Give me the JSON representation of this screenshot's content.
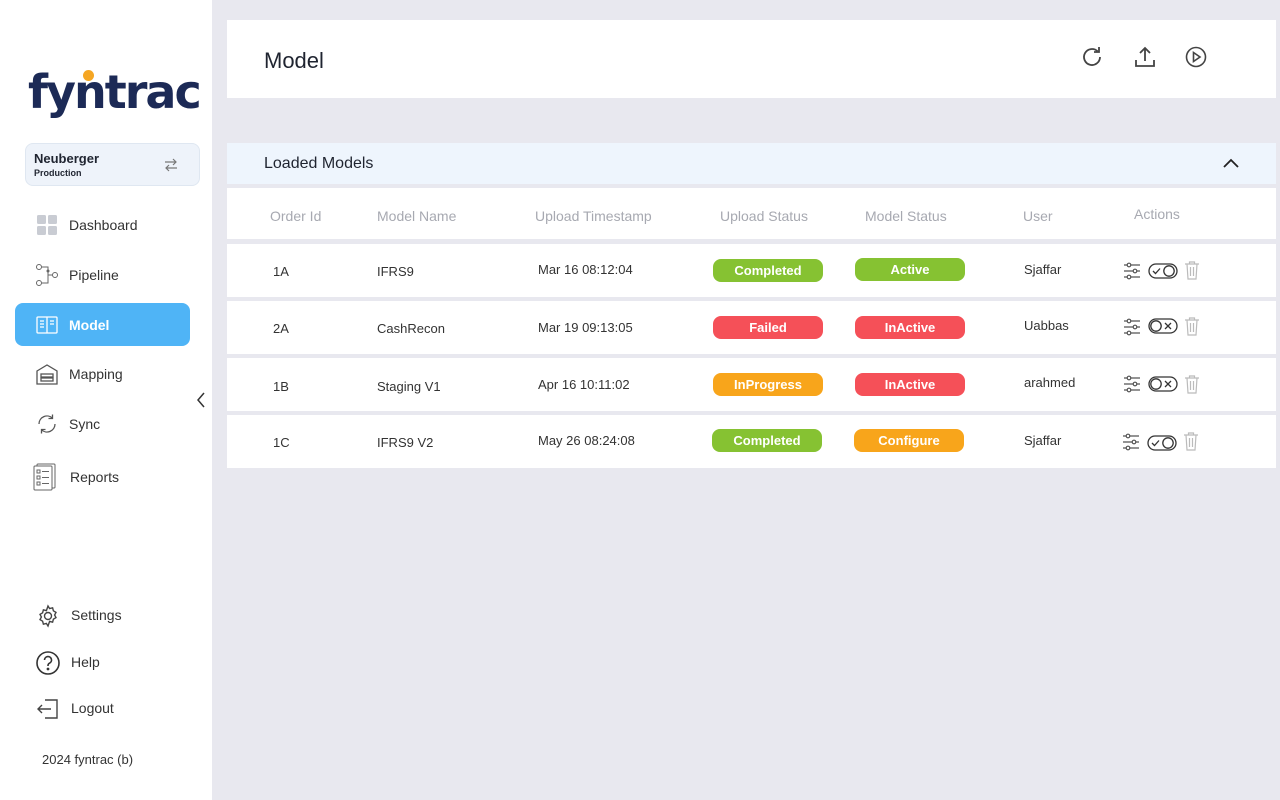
{
  "brand": {
    "logo_text": "fyntrac"
  },
  "org": {
    "name": "Neuberger",
    "environment": "Production"
  },
  "sidebar": {
    "items": [
      {
        "label": "Dashboard",
        "icon": "dashboard-icon"
      },
      {
        "label": "Pipeline",
        "icon": "pipeline-icon"
      },
      {
        "label": "Model",
        "icon": "model-icon",
        "active": true
      },
      {
        "label": "Mapping",
        "icon": "mapping-icon"
      },
      {
        "label": "Sync",
        "icon": "sync-icon"
      },
      {
        "label": "Reports",
        "icon": "reports-icon"
      }
    ],
    "bottom": [
      {
        "label": "Settings",
        "icon": "gear-icon"
      },
      {
        "label": "Help",
        "icon": "help-icon"
      },
      {
        "label": "Logout",
        "icon": "logout-icon"
      }
    ],
    "copyright": "2024 fyntrac (b)"
  },
  "header": {
    "title": "Model",
    "actions": [
      "refresh-icon",
      "upload-icon",
      "play-icon"
    ]
  },
  "section": {
    "title": "Loaded Models",
    "expanded": true
  },
  "table": {
    "columns": [
      "Order Id",
      "Model Name",
      "Upload Timestamp",
      "Upload Status",
      "Model Status",
      "User",
      "Actions"
    ],
    "rows": [
      {
        "order_id": "1A",
        "model_name": "IFRS9",
        "timestamp": "Mar 16 08:12:04",
        "upload_status": "Completed",
        "model_status": "Active",
        "user": "Sjaffar",
        "toggle": "on"
      },
      {
        "order_id": "2A",
        "model_name": "CashRecon",
        "timestamp": "Mar 19 09:13:05",
        "upload_status": "Failed",
        "model_status": "InActive",
        "user": "Uabbas",
        "toggle": "off"
      },
      {
        "order_id": "1B",
        "model_name": "Staging V1",
        "timestamp": "Apr 16 10:11:02",
        "upload_status": "InProgress",
        "model_status": "InActive",
        "user": "arahmed",
        "toggle": "off"
      },
      {
        "order_id": "1C",
        "model_name": "IFRS9 V2",
        "timestamp": "May 26 08:24:08",
        "upload_status": "Completed",
        "model_status": "Configure",
        "user": "Sjaffar",
        "toggle": "on"
      }
    ]
  },
  "colors": {
    "accent": "#4fb4f6",
    "brand": "#1c2a56",
    "success": "#86c232",
    "danger": "#f55058",
    "warning": "#f8a51b"
  }
}
